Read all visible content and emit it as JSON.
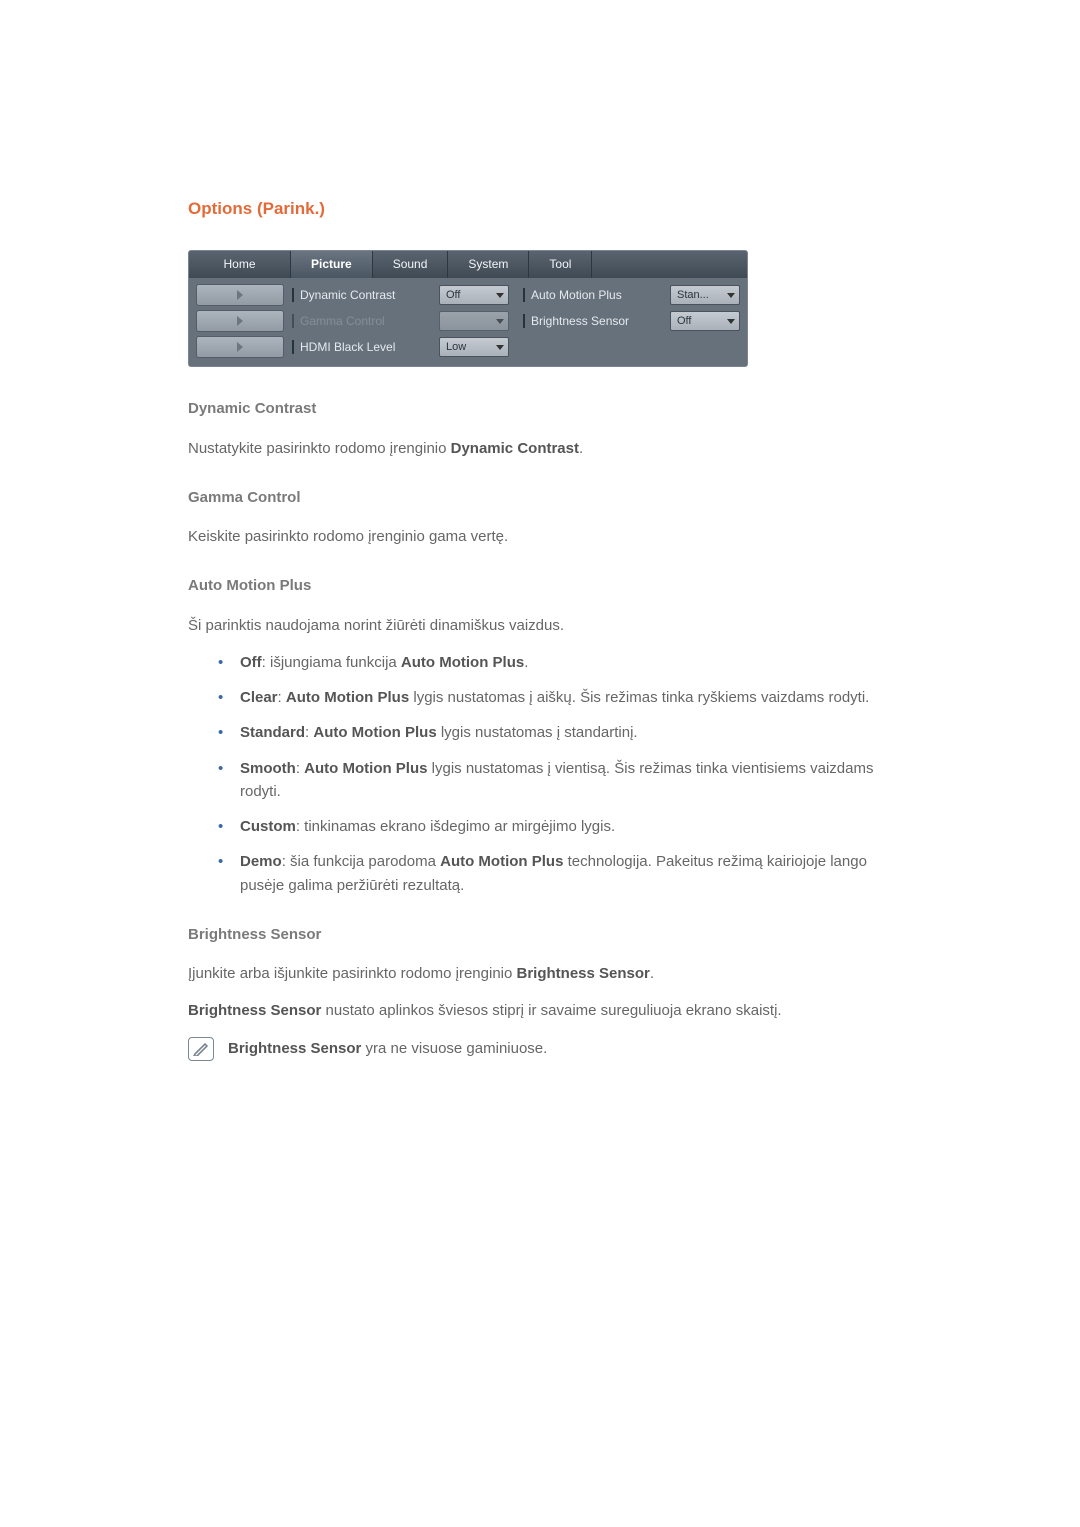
{
  "heading": "Options (Parink.)",
  "tabs": [
    "Home",
    "Picture",
    "Sound",
    "System",
    "Tool"
  ],
  "activeTab": 1,
  "leftSettings": [
    {
      "label": "Dynamic Contrast",
      "value": "Off",
      "disabled": false
    },
    {
      "label": "Gamma Control",
      "value": "",
      "disabled": true
    },
    {
      "label": "HDMI Black Level",
      "value": "Low",
      "disabled": false
    }
  ],
  "rightSettings": [
    {
      "label": "Auto Motion Plus",
      "value": "Stan...",
      "disabled": false
    },
    {
      "label": "Brightness Sensor",
      "value": "Off",
      "disabled": false
    }
  ],
  "sec1": {
    "title": "Dynamic Contrast",
    "p_a": "Nustatykite pasirinkto rodomo įrenginio ",
    "p_b": "Dynamic Contrast",
    "p_c": "."
  },
  "sec2": {
    "title": "Gamma Control",
    "p": "Keiskite pasirinkto rodomo įrenginio gama vertę."
  },
  "sec3": {
    "title": "Auto Motion Plus",
    "intro": "Ši parinktis naudojama norint žiūrėti dinamiškus vaizdus.",
    "items": [
      {
        "b": "Off",
        "t1": ": išjungiama funkcija ",
        "b2": "Auto Motion Plus",
        "t2": "."
      },
      {
        "b": "Clear",
        "t1": ": ",
        "b2": "Auto Motion Plus",
        "t2": " lygis nustatomas į aiškų. Šis režimas tinka ryškiems vaizdams rodyti."
      },
      {
        "b": "Standard",
        "t1": ": ",
        "b2": "Auto Motion Plus",
        "t2": " lygis nustatomas į standartinį."
      },
      {
        "b": "Smooth",
        "t1": ": ",
        "b2": "Auto Motion Plus",
        "t2": " lygis nustatomas į vientisą. Šis režimas tinka vientisiems vaizdams rodyti."
      },
      {
        "b": "Custom",
        "t1": ": tinkinamas ekrano išdegimo ar mirgėjimo lygis.",
        "b2": "",
        "t2": ""
      },
      {
        "b": "Demo",
        "t1": ": šia funkcija parodoma ",
        "b2": "Auto Motion Plus",
        "t2": " technologija. Pakeitus režimą kairiojoje lango pusėje galima peržiūrėti rezultatą."
      }
    ]
  },
  "sec4": {
    "title": "Brightness Sensor",
    "p1a": "Įjunkite arba išjunkite pasirinkto rodomo įrenginio ",
    "p1b": "Brightness Sensor",
    "p1c": ".",
    "p2a": "Brightness Sensor",
    "p2b": " nustato aplinkos šviesos stiprį ir savaime sureguliuoja ekrano skaistį.",
    "noteA": "Brightness Sensor",
    "noteB": " yra ne visuose gaminiuose."
  }
}
